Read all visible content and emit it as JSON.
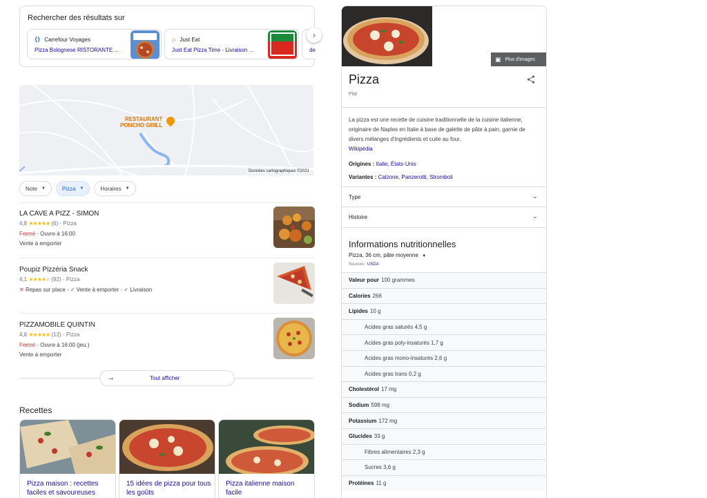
{
  "search_on": {
    "title": "Rechercher des résultats sur",
    "cards": [
      {
        "source": "Carrefour Voyages",
        "link": "Pizza Bolognese RISTORANTE ..."
      },
      {
        "source": "Just Eat",
        "link": "Just Eat Pizza Time - Livraison ..."
      },
      {
        "source": "",
        "link": "del"
      }
    ]
  },
  "map": {
    "place_label_line1": "RESTAURANT",
    "place_label_line2": "PONCHO GRILL",
    "copyright": "Données cartographiques ©2021"
  },
  "chips": [
    {
      "label": "Note",
      "active": false
    },
    {
      "label": "Pizza",
      "active": true
    },
    {
      "label": "Horaires",
      "active": false
    }
  ],
  "places": [
    {
      "name": "LA CAVE A PIZZ - SIMON",
      "rating": "4,8",
      "stars": "★★★★★",
      "reviews": "(6)",
      "category": "Pizza",
      "status": "Fermé",
      "hours": "· Ouvre à 16:00",
      "extra": "Vente à emporter"
    },
    {
      "name": "Poupiz Pizzéria Snack",
      "rating": "4,1",
      "stars": "★★★★",
      "stars_empty": "★",
      "reviews": "(92)",
      "category": "Pizza",
      "service_1": "Repas sur place",
      "service_2": "Vente à emporter",
      "service_3": "Livraison"
    },
    {
      "name": "PIZZAMOBILE QUINTIN",
      "rating": "4,8",
      "stars": "★★★★★",
      "reviews": "(12)",
      "category": "Pizza",
      "status": "Fermé",
      "hours": "· Ouvre à 16:00 (jeu.)",
      "extra": "Vente à emporter"
    }
  ],
  "show_all": "Tout afficher",
  "recipes": {
    "title": "Recettes",
    "items": [
      {
        "title": "Pizza maison : recettes faciles et savoureuses"
      },
      {
        "title": "15 idées de pizza pour tous les goûts"
      },
      {
        "title": "Pizza italienne maison facile"
      }
    ]
  },
  "knowledge_panel": {
    "more_images": "Plus d'images",
    "title": "Pizza",
    "subtitle": "Plat",
    "description": "La pizza est une recette de cuisine traditionnelle de la cuisine italienne, originaire de Naples en Italie à base de galette de pâte à pain, garnie de divers mélanges d'ingrédients et cuite au four.",
    "wiki_link": "Wikipédia",
    "origins_label": "Origines :",
    "origins_value": "Italie, États-Unis",
    "variants_label": "Variantes :",
    "variants_value": "Calzone, Panzerotti, Stromboli",
    "accordions": [
      "Type",
      "Histoire"
    ],
    "nutrition": {
      "title": "Informations nutritionnelles",
      "serving": "Pizza, 36 cm, pâte moyenne",
      "sources_label": "Sources :",
      "sources_link": "USDA",
      "rows": [
        {
          "label": "Valeur pour",
          "value": "100 grammes",
          "sub": false
        },
        {
          "label": "Calories",
          "value": "266",
          "sub": false
        },
        {
          "label": "Lipides",
          "value": "10 g",
          "sub": false
        },
        {
          "label": "",
          "value": "Acides gras saturés 4,5 g",
          "sub": true
        },
        {
          "label": "",
          "value": "Acides gras poly-insaturés 1,7 g",
          "sub": true
        },
        {
          "label": "",
          "value": "Acides gras mono-insaturés 2,6 g",
          "sub": true
        },
        {
          "label": "",
          "value": "Acides gras trans 0,2 g",
          "sub": true
        },
        {
          "label": "Cholestérol",
          "value": "17 mg",
          "sub": false
        },
        {
          "label": "Sodium",
          "value": "598 mg",
          "sub": false
        },
        {
          "label": "Potassium",
          "value": "172 mg",
          "sub": false
        },
        {
          "label": "Glucides",
          "value": "33 g",
          "sub": false
        },
        {
          "label": "",
          "value": "Fibres alimentaires 2,3 g",
          "sub": true
        },
        {
          "label": "",
          "value": "Sucres 3,6 g",
          "sub": true
        },
        {
          "label": "Protéines",
          "value": "11 g",
          "sub": false
        }
      ]
    }
  }
}
